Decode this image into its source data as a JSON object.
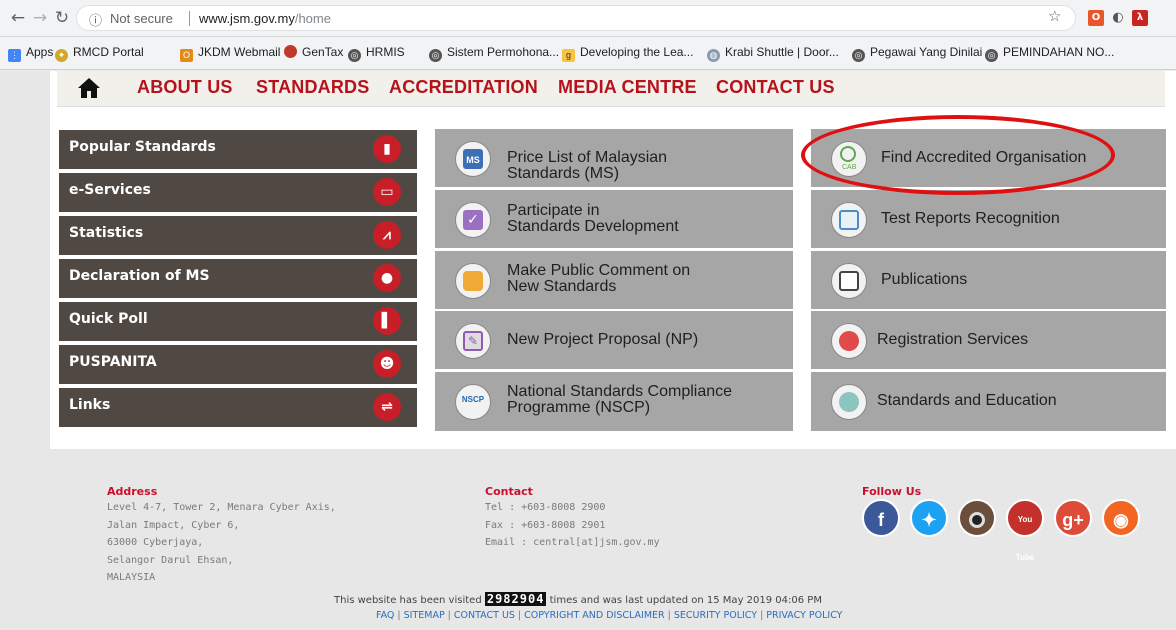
{
  "browser": {
    "security_label": "Not secure",
    "url_host": "www.jsm.gov.my",
    "url_path": "/home",
    "bookmarks": [
      "Apps",
      "RMCD Portal",
      "JKDM Webmail",
      "GenTax",
      "HRMIS",
      "Sistem Permohona...",
      "Developing the Lea...",
      "Krabi Shuttle | Door...",
      "Pegawai Yang Dinilai",
      "PEMINDAHAN NO..."
    ]
  },
  "nav": {
    "items": [
      "ABOUT US",
      "STANDARDS",
      "ACCREDITATION",
      "MEDIA CENTRE",
      "CONTACT US"
    ]
  },
  "left_menu": [
    {
      "label": "Popular Standards",
      "icon": "book-icon"
    },
    {
      "label": "e-Services",
      "icon": "monitor-icon"
    },
    {
      "label": "Statistics",
      "icon": "trend-chart-icon"
    },
    {
      "label": "Declaration of MS",
      "icon": "magnifier-icon"
    },
    {
      "label": "Quick Poll",
      "icon": "bar-chart-icon"
    },
    {
      "label": "PUSPANITA",
      "icon": "people-icon"
    },
    {
      "label": "Links",
      "icon": "link-arrows-icon"
    }
  ],
  "tiles_mid": [
    {
      "line1": "Price List of Malaysian",
      "line2": "Standards (MS)",
      "icon": "ms-document-icon"
    },
    {
      "line1": "Participate in",
      "line2": "Standards Development",
      "icon": "checkbox-icon"
    },
    {
      "line1": "Make Public Comment on",
      "line2": "New Standards",
      "icon": "comment-icon"
    },
    {
      "line1": "New Project Proposal (NP)",
      "line2": "",
      "icon": "edit-icon"
    },
    {
      "line1": "National Standards Compliance",
      "line2": "Programme (NSCP)",
      "icon": "nscp-icon"
    }
  ],
  "tiles_right": [
    {
      "line1": "Find Accredited Organisation",
      "icon": "cab-search-icon"
    },
    {
      "line1": "Test Reports Recognition",
      "icon": "report-icon"
    },
    {
      "line1": "Publications",
      "icon": "publication-icon"
    },
    {
      "line1": "Registration Services",
      "icon": "hand-icon"
    },
    {
      "line1": "Standards and Education",
      "icon": "graduate-icon"
    }
  ],
  "icon_labels": {
    "ms": "MS",
    "cab": "CAB",
    "nscp": "NSCP"
  },
  "footer": {
    "address_title": "Address",
    "address_lines": "Level 4-7, Tower 2, Menara Cyber Axis,\nJalan Impact, Cyber 6,\n63000 Cyberjaya,\nSelangor Darul Ehsan,\nMALAYSIA",
    "contact_title": "Contact",
    "contact_lines": "Tel : +603-8008 2900\nFax : +603-8008 2901\nEmail : central[at]jsm.gov.my",
    "follow_title": "Follow Us",
    "social": [
      "f",
      "t",
      "cam",
      "You Tube",
      "g+",
      "rss"
    ],
    "visited_prefix": "This website has been visited",
    "visited_count": "2982904",
    "visited_suffix": "times and was last updated on 15 May 2019 04:06 PM",
    "links": [
      "FAQ",
      "SITEMAP",
      "CONTACT US",
      "COPYRIGHT AND DISCLAIMER",
      "SECURITY POLICY",
      "PRIVACY POLICY"
    ]
  }
}
